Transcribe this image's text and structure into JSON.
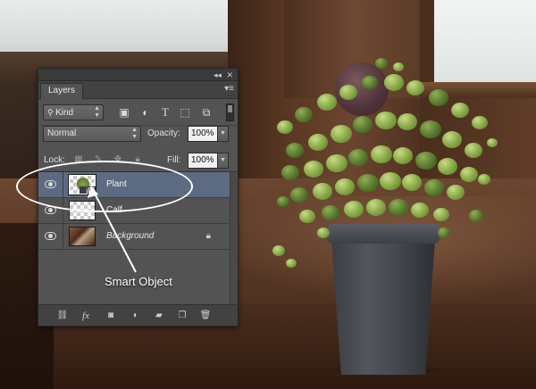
{
  "panel": {
    "tab_label": "Layers",
    "collapse_glyph": "◂◂",
    "close_glyph": "✕",
    "menu_glyph": "▾≡",
    "filter_kind": "Kind",
    "filter_icons": [
      "image-filter-icon",
      "adjustment-filter-icon",
      "type-filter-icon",
      "shape-filter-icon",
      "smart-object-filter-icon"
    ],
    "blend_mode": "Normal",
    "opacity_label": "Opacity:",
    "opacity_value": "100%",
    "lock_label": "Lock:",
    "fill_label": "Fill:",
    "fill_value": "100%",
    "layers": [
      {
        "name": "Plant",
        "type": "smart-object",
        "selected": true,
        "visible": true,
        "italic": false,
        "locked": false
      },
      {
        "name": "Calf",
        "type": "pixel",
        "selected": false,
        "visible": true,
        "italic": false,
        "locked": false
      },
      {
        "name": "Background",
        "type": "background",
        "selected": false,
        "visible": true,
        "italic": true,
        "locked": true
      }
    ],
    "bottom_icons": [
      "link-layers-icon",
      "fx-icon",
      "layer-mask-icon",
      "adjustment-layer-icon",
      "group-folder-icon",
      "new-layer-icon",
      "trash-icon"
    ],
    "fx_label": "fx"
  },
  "annotation": {
    "label": "Smart Object",
    "color": "#ffffff"
  },
  "colors": {
    "panel_bg": "#535353",
    "selected_row": "#5d6b82"
  }
}
